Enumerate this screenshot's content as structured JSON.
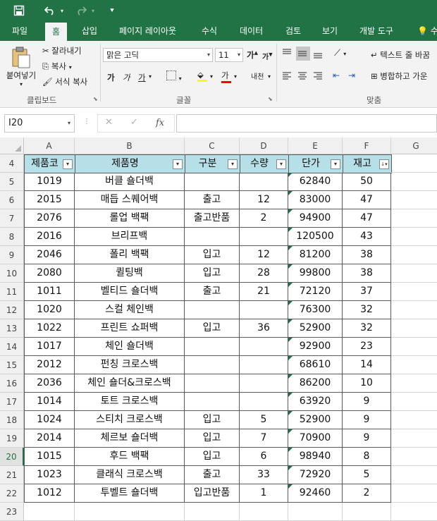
{
  "titlebar": {
    "save_icon": "save-icon",
    "undo_icon": "undo-icon",
    "redo_icon": "redo-icon",
    "customize_icon": "customize-qat-icon"
  },
  "tabs": [
    {
      "label": "파일"
    },
    {
      "label": "홈"
    },
    {
      "label": "삽입"
    },
    {
      "label": "페이지 레이아웃"
    },
    {
      "label": "수식"
    },
    {
      "label": "데이터"
    },
    {
      "label": "검토"
    },
    {
      "label": "보기"
    },
    {
      "label": "개발 도구"
    },
    {
      "label": "수"
    }
  ],
  "ribbon": {
    "clipboard": {
      "paste": "붙여넣기",
      "cut": "잘라내기",
      "copy": "복사",
      "format_painter": "서식 복사",
      "label": "클립보드"
    },
    "font": {
      "font_name": "맑은 고딕",
      "font_size": "11",
      "label": "글꼴",
      "bold": "가",
      "italic": "가",
      "underline": "가",
      "grow": "가",
      "shrink": "가",
      "font_color_glyph": "가",
      "phonetic": "내천"
    },
    "alignment": {
      "wrap_text": "텍스트 줄 바꿈",
      "merge": "병합하고 가운",
      "label": "맞춤"
    }
  },
  "formulabar": {
    "namebox": "I20",
    "fx": "fx",
    "cancel": "✕",
    "enter": "✓"
  },
  "columns": [
    "A",
    "B",
    "C",
    "D",
    "E",
    "F",
    "G"
  ],
  "row_numbers": [
    "4",
    "5",
    "6",
    "7",
    "8",
    "9",
    "10",
    "11",
    "12",
    "13",
    "14",
    "15",
    "16",
    "17",
    "18",
    "19",
    "20",
    "21",
    "22",
    "23"
  ],
  "table": {
    "headers": [
      "제품코",
      "제품명",
      "구분",
      "수량",
      "단가",
      "재고"
    ],
    "rows": [
      [
        "1019",
        "버클 숄더백",
        "",
        "",
        "62840",
        "50"
      ],
      [
        "2015",
        "매듭 스퀘어백",
        "출고",
        "12",
        "83000",
        "47"
      ],
      [
        "2076",
        "롤업 백팩",
        "출고반품",
        "2",
        "94900",
        "47"
      ],
      [
        "2016",
        "브리프백",
        "",
        "",
        "120500",
        "43"
      ],
      [
        "2046",
        "폴리 백팩",
        "입고",
        "12",
        "81200",
        "38"
      ],
      [
        "2080",
        "퀼팅백",
        "입고",
        "28",
        "99800",
        "38"
      ],
      [
        "1011",
        "벨티드 숄더백",
        "출고",
        "21",
        "72120",
        "37"
      ],
      [
        "1020",
        "스컬 체인백",
        "",
        "",
        "76300",
        "32"
      ],
      [
        "1022",
        "프린트 쇼퍼백",
        "입고",
        "36",
        "52900",
        "32"
      ],
      [
        "1017",
        "체인 숄더백",
        "",
        "",
        "92900",
        "23"
      ],
      [
        "2012",
        "펀칭 크로스백",
        "",
        "",
        "68610",
        "14"
      ],
      [
        "2036",
        "체인 숄더&크로스백",
        "",
        "",
        "86200",
        "10"
      ],
      [
        "1014",
        "토트 크로스백",
        "",
        "",
        "63920",
        "9"
      ],
      [
        "1024",
        "스티치 크로스백",
        "입고",
        "5",
        "52900",
        "9"
      ],
      [
        "2014",
        "체르보 숄더백",
        "입고",
        "7",
        "70900",
        "9"
      ],
      [
        "1015",
        "후드 백팩",
        "입고",
        "6",
        "98940",
        "8"
      ],
      [
        "1023",
        "클래식 크로스백",
        "출고",
        "33",
        "72920",
        "5"
      ],
      [
        "1012",
        "투벨트 숄더백",
        "입고반품",
        "1",
        "92460",
        "2"
      ]
    ]
  },
  "colors": {
    "excel_green": "#217346",
    "header_fill": "#b7dfe8",
    "selected_row": "#217346"
  }
}
